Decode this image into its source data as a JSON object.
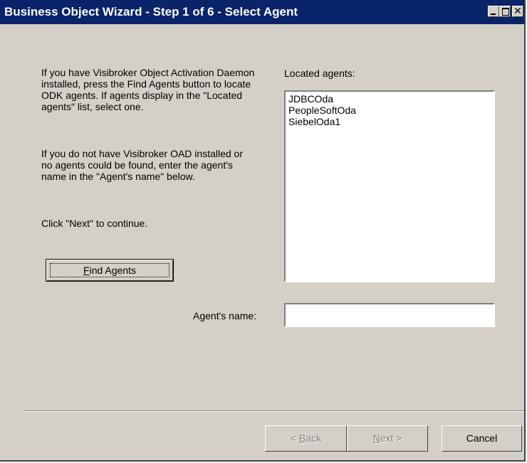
{
  "window": {
    "title": "Business Object Wizard - Step 1 of 6 - Select Agent",
    "minimize_glyph": "minimize-icon",
    "maximize_glyph": "maximize-icon",
    "close_glyph": "✕"
  },
  "instructions": {
    "p1": "If you have Visibroker Object Activation Daemon installed, press the Find Agents button to locate ODK agents. If agents display in the \"Located agents\" list, select one.",
    "p2": "If you do not have Visibroker OAD installed or no agents could be found, enter the agent's name in the \"Agent's name\" below.",
    "p3": "Click \"Next\" to continue."
  },
  "find_agents": {
    "label_accel": "F",
    "label_rest": "ind Agents"
  },
  "located_agents": {
    "label": "Located agents:",
    "items": [
      "JDBCOda",
      "PeopleSoftOda",
      "SiebelOda1"
    ]
  },
  "agent_name": {
    "label": "Agent's name:",
    "value": ""
  },
  "buttons": {
    "back_pre": "< ",
    "back_accel": "B",
    "back_post": "ack",
    "next_accel": "N",
    "next_post": "ext >",
    "cancel": "Cancel"
  },
  "colors": {
    "face": "#d4d0c8",
    "titlebar": "#0a246a"
  }
}
